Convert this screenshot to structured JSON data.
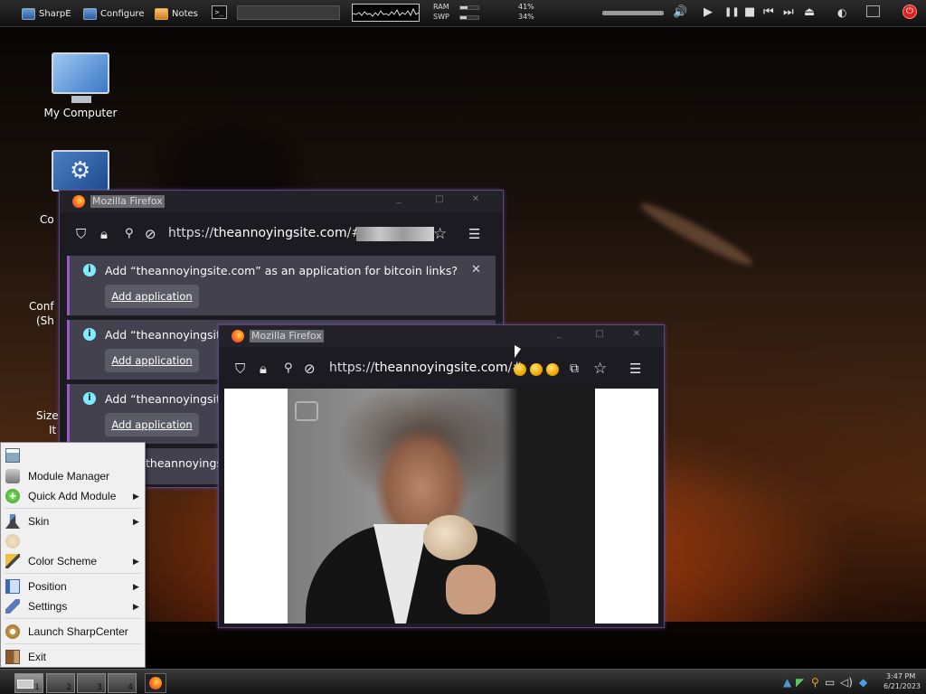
{
  "topbar": {
    "items": [
      {
        "label": "SharpE",
        "icon": "sharpe-icon"
      },
      {
        "label": "Configure",
        "icon": "configure-icon"
      },
      {
        "label": "Notes",
        "icon": "notes-icon"
      }
    ],
    "terminal_glyph": ">_",
    "ram_label": "RAM",
    "swp_label": "SWP",
    "ram_percent": "41%",
    "swp_percent": "34%",
    "ram_fraction": 0.41,
    "swp_fraction": 0.34,
    "media_glyphs": {
      "volume": "🔊",
      "play": "▶",
      "pause": "❚❚",
      "stop": "■",
      "prev": "⏮",
      "next": "⏭",
      "eject": "⏏"
    },
    "power_glyph": "⏻"
  },
  "desktop": {
    "icons": [
      {
        "label": "My Computer"
      },
      {
        "label": "Co"
      }
    ],
    "partial_labels": [
      "Conf",
      "(Sh",
      "Size",
      "It"
    ]
  },
  "firefox_back": {
    "title": "Mozilla Firefox",
    "url_prefix": "https://",
    "url_domain": "theannoyingsite.com",
    "url_suffix": "/#",
    "notifications": [
      {
        "message": "Add “theannoyingsite.com” as an application for bitcoin links?",
        "button": "Add application"
      },
      {
        "message": "Add “theannoyingsite.c",
        "button": "Add application"
      },
      {
        "message": "Add “theannoyingsite.c",
        "button": "Add application"
      },
      {
        "message": "theannoyingsite.c",
        "button": ""
      }
    ],
    "close_glyph": "✕",
    "menu_glyph": "☰",
    "star_glyph": "☆"
  },
  "firefox_front": {
    "title": "Mozilla Firefox",
    "url_prefix": "https://",
    "url_domain": "theannoyingsite.com",
    "url_suffix": "/#",
    "menu_glyph": "☰",
    "star_glyph": "☆"
  },
  "context_menu": {
    "items": [
      {
        "label": "",
        "icon": "window-icon",
        "submenu": false,
        "disabled": true
      },
      {
        "label": "Module Manager",
        "icon": "module-manager-icon",
        "submenu": false,
        "disabled": false
      },
      {
        "label": "Quick Add Module",
        "icon": "add-icon",
        "submenu": true,
        "disabled": false
      },
      {
        "label": "Skin",
        "icon": "skin-icon",
        "submenu": true,
        "disabled": false
      },
      {
        "label": "",
        "icon": "paint-icon",
        "submenu": false,
        "disabled": true
      },
      {
        "label": "Color Scheme",
        "icon": "brush-icon",
        "submenu": true,
        "disabled": false
      },
      {
        "label": "Position",
        "icon": "position-icon",
        "submenu": true,
        "disabled": false
      },
      {
        "label": "Settings",
        "icon": "wrench-icon",
        "submenu": true,
        "disabled": false
      },
      {
        "label": "Launch SharpCenter",
        "icon": "gear-icon",
        "submenu": false,
        "disabled": false
      },
      {
        "label": "Exit",
        "icon": "exit-icon",
        "submenu": false,
        "disabled": false
      }
    ],
    "arrow_glyph": "▶"
  },
  "taskbar": {
    "workspaces": [
      "1",
      "2",
      "3",
      "4"
    ],
    "clock_time": "3:47 PM",
    "clock_date": "6/21/2023"
  }
}
